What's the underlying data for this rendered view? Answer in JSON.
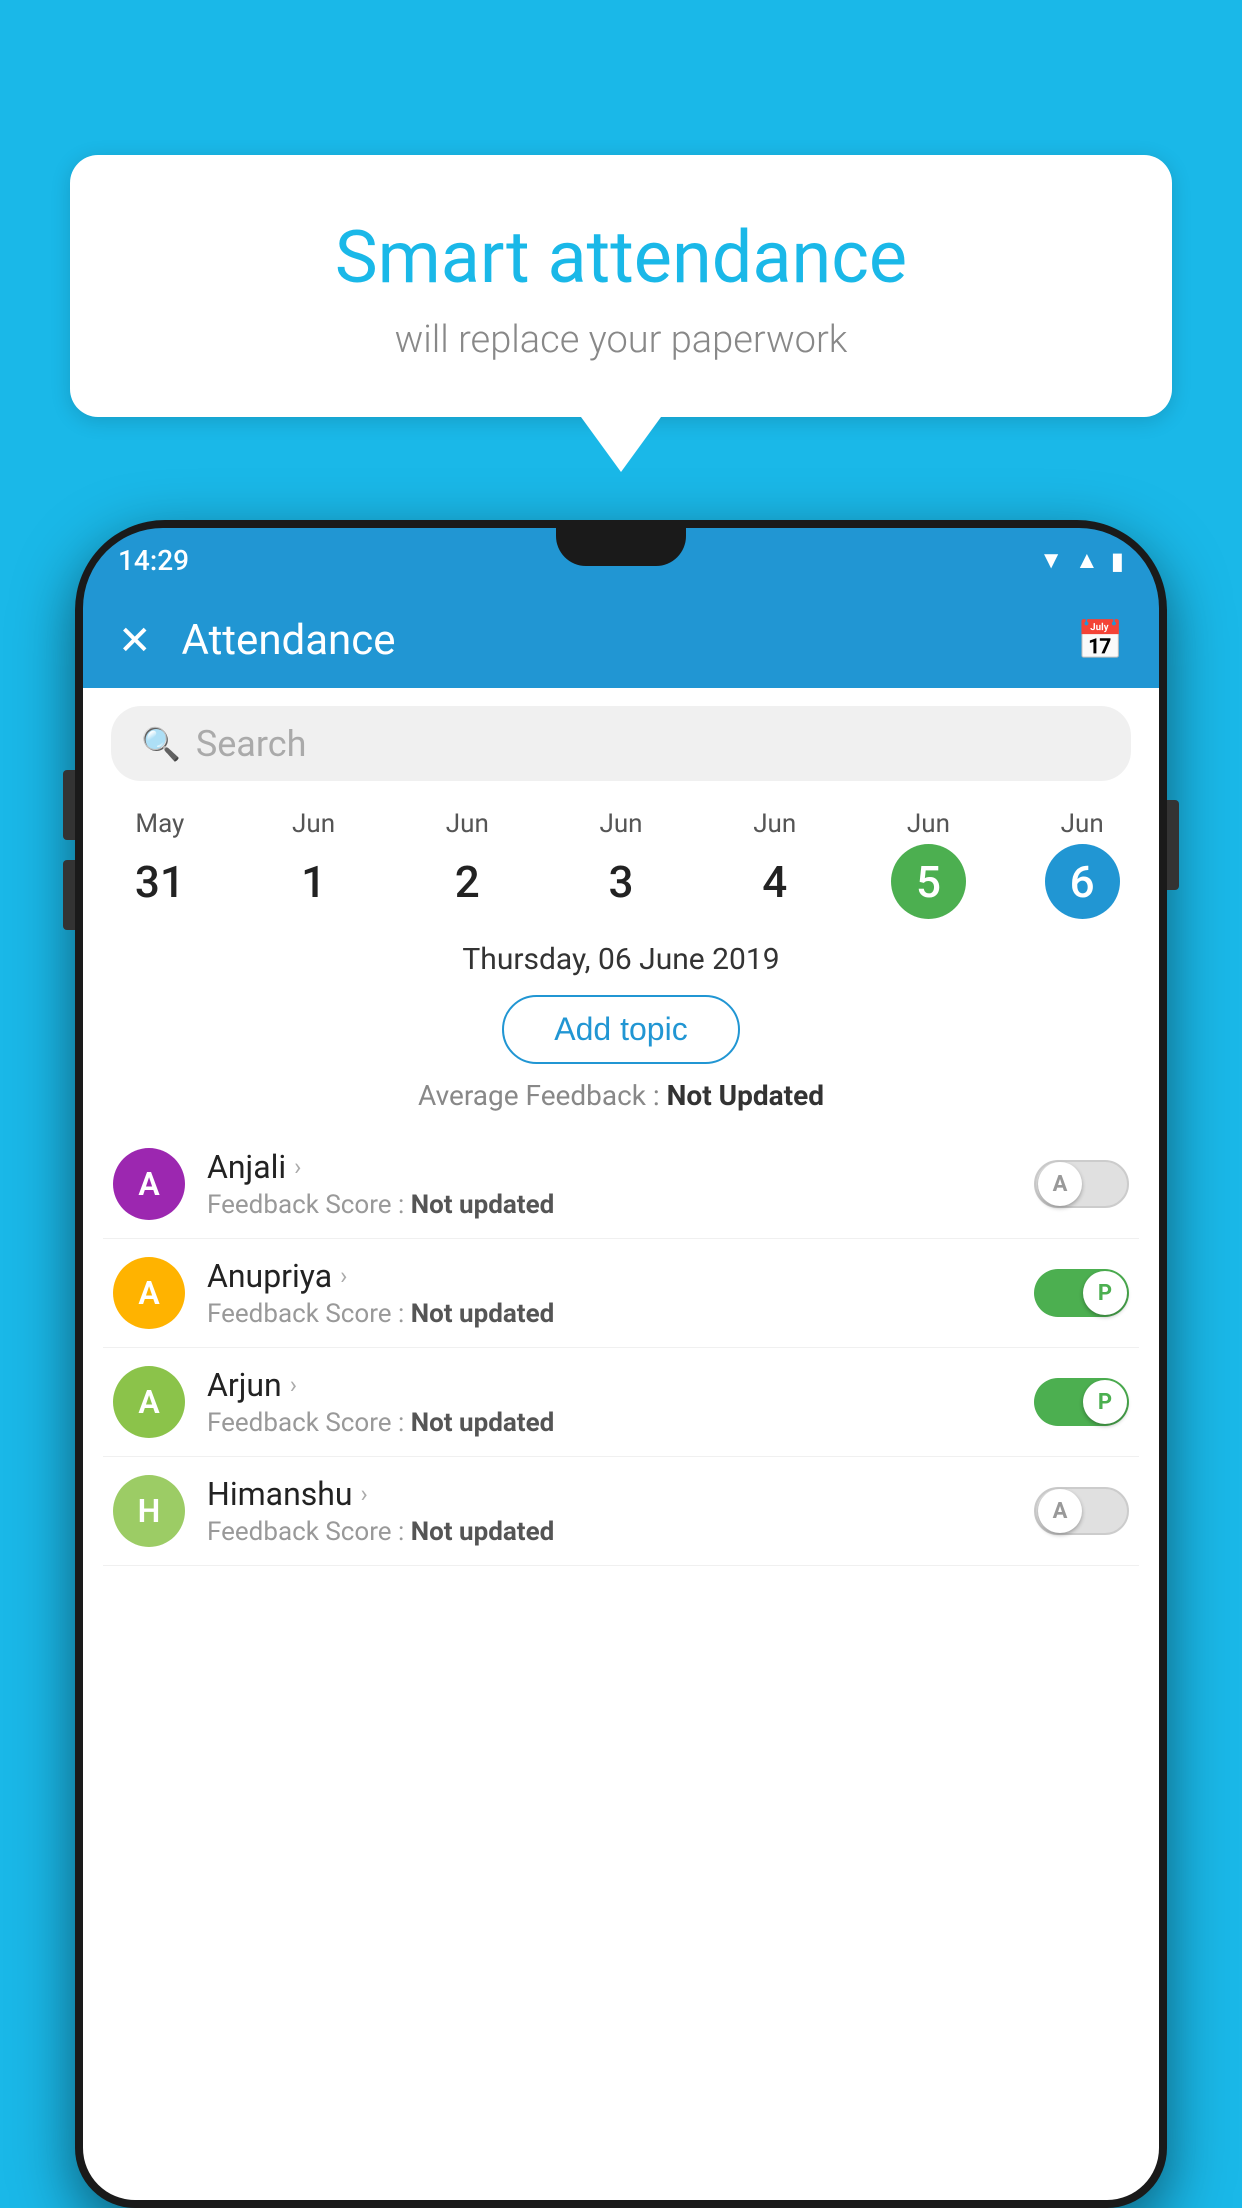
{
  "background_color": "#1ab8e8",
  "speech_bubble": {
    "title": "Smart attendance",
    "subtitle": "will replace your paperwork",
    "arrow": true
  },
  "status_bar": {
    "time": "14:29",
    "icons": [
      "wifi",
      "signal",
      "battery"
    ]
  },
  "app_bar": {
    "title": "Attendance",
    "close_label": "✕",
    "calendar_icon": "📅"
  },
  "search": {
    "placeholder": "Search"
  },
  "dates": [
    {
      "month": "May",
      "day": "31",
      "selected": false
    },
    {
      "month": "Jun",
      "day": "1",
      "selected": false
    },
    {
      "month": "Jun",
      "day": "2",
      "selected": false
    },
    {
      "month": "Jun",
      "day": "3",
      "selected": false
    },
    {
      "month": "Jun",
      "day": "4",
      "selected": false
    },
    {
      "month": "Jun",
      "day": "5",
      "selected": "green"
    },
    {
      "month": "Jun",
      "day": "6",
      "selected": "blue"
    }
  ],
  "selected_date": "Thursday, 06 June 2019",
  "add_topic_label": "Add topic",
  "avg_feedback_label": "Average Feedback :",
  "avg_feedback_value": "Not Updated",
  "students": [
    {
      "name": "Anjali",
      "avatar_letter": "A",
      "avatar_color": "#9c27b0",
      "feedback_label": "Feedback Score :",
      "feedback_value": "Not updated",
      "toggle": "off",
      "toggle_letter": "A"
    },
    {
      "name": "Anupriya",
      "avatar_letter": "A",
      "avatar_color": "#ffb300",
      "feedback_label": "Feedback Score :",
      "feedback_value": "Not updated",
      "toggle": "on",
      "toggle_letter": "P"
    },
    {
      "name": "Arjun",
      "avatar_letter": "A",
      "avatar_color": "#8bc34a",
      "feedback_label": "Feedback Score :",
      "feedback_value": "Not updated",
      "toggle": "on",
      "toggle_letter": "P"
    },
    {
      "name": "Himanshu",
      "avatar_letter": "H",
      "avatar_color": "#9ccc65",
      "feedback_label": "Feedback Score :",
      "feedback_value": "Not updated",
      "toggle": "off",
      "toggle_letter": "A"
    }
  ]
}
